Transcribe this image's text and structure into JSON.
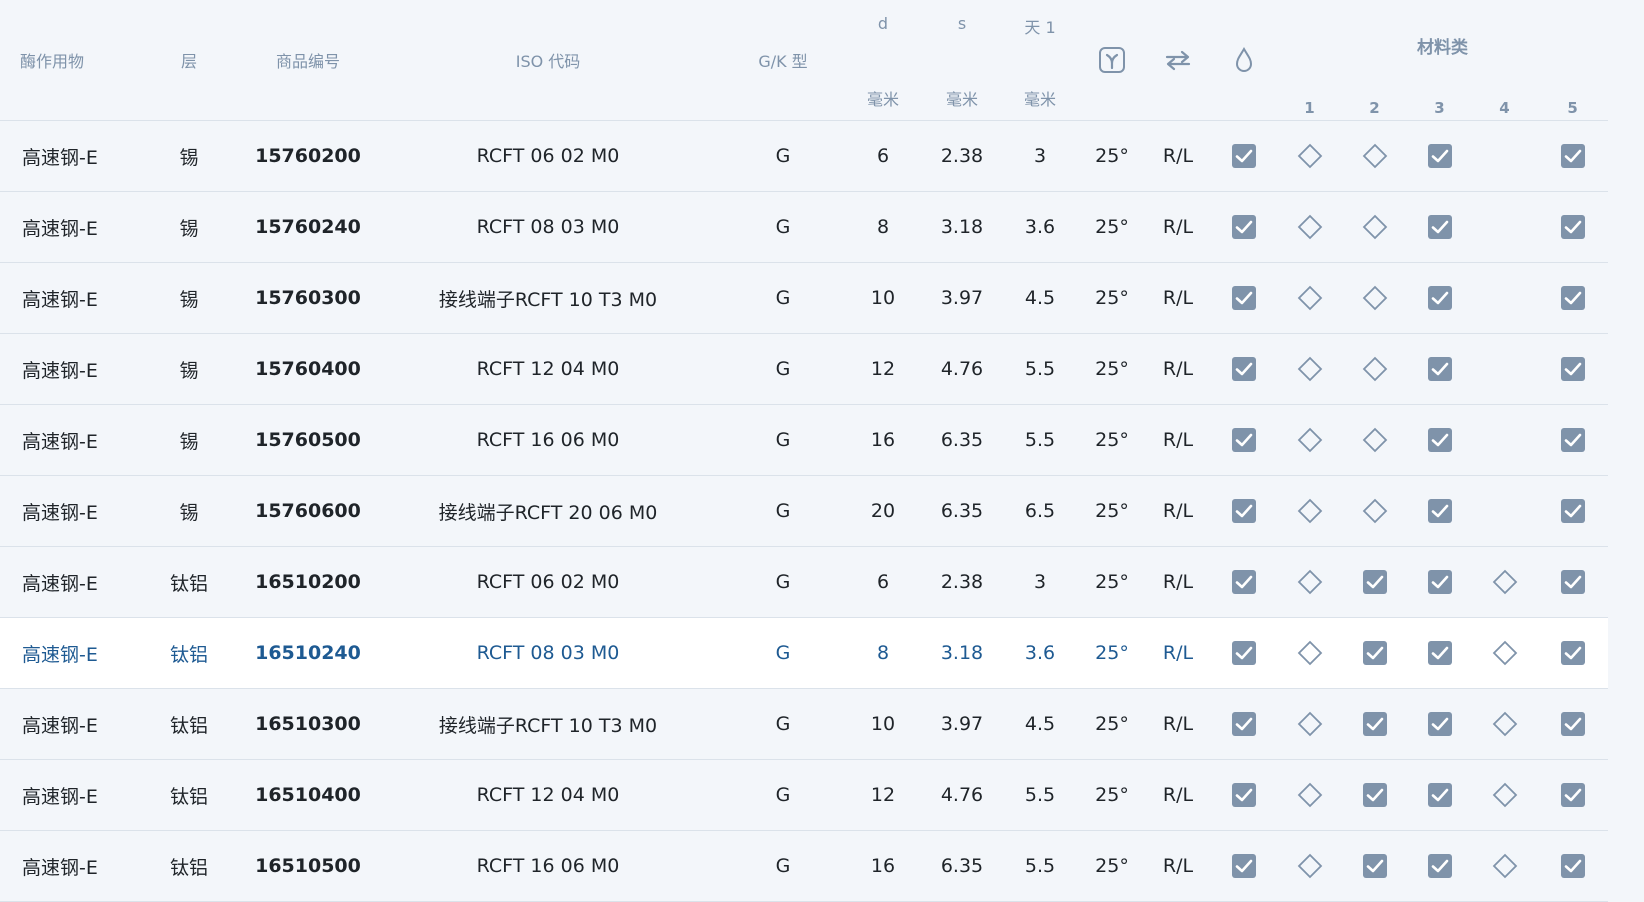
{
  "header": {
    "enzyme": "酶作用物",
    "layer": "层",
    "part_no": "商品编号",
    "iso": "ISO 代码",
    "gk": "G/K 型",
    "d": "d",
    "s": "s",
    "t1": "天 1",
    "unit_mm": "毫米",
    "gamma_icon": "gamma-angle-icon",
    "swap_icon": "swap-direction-icon",
    "drop_icon": "coolant-drop-icon",
    "material_title": "材料类",
    "material_cols": [
      "1",
      "2",
      "3",
      "4",
      "5"
    ]
  },
  "colors": {
    "checkbox": "#7f93aa",
    "selected_text": "#1e5a92",
    "header_text": "#7f93aa",
    "row_bg": "#f3f6fa",
    "selected_bg": "#ffffff"
  },
  "rows": [
    {
      "enzyme": "高速钢-E",
      "layer": "锡",
      "part_no": "15760200",
      "iso": "RCFT 06 02 M0",
      "gk": "G",
      "d": "6",
      "s": "2.38",
      "t1": "3",
      "angle": "25°",
      "dir": "R/L",
      "cool": "check",
      "mats": [
        "diamond",
        "diamond",
        "check",
        "",
        "check"
      ]
    },
    {
      "enzyme": "高速钢-E",
      "layer": "锡",
      "part_no": "15760240",
      "iso": "RCFT 08 03 M0",
      "gk": "G",
      "d": "8",
      "s": "3.18",
      "t1": "3.6",
      "angle": "25°",
      "dir": "R/L",
      "cool": "check",
      "mats": [
        "diamond",
        "diamond",
        "check",
        "",
        "check"
      ]
    },
    {
      "enzyme": "高速钢-E",
      "layer": "锡",
      "part_no": "15760300",
      "iso": "接线端子RCFT 10 T3 M0",
      "gk": "G",
      "d": "10",
      "s": "3.97",
      "t1": "4.5",
      "angle": "25°",
      "dir": "R/L",
      "cool": "check",
      "mats": [
        "diamond",
        "diamond",
        "check",
        "",
        "check"
      ]
    },
    {
      "enzyme": "高速钢-E",
      "layer": "锡",
      "part_no": "15760400",
      "iso": "RCFT 12 04 M0",
      "gk": "G",
      "d": "12",
      "s": "4.76",
      "t1": "5.5",
      "angle": "25°",
      "dir": "R/L",
      "cool": "check",
      "mats": [
        "diamond",
        "diamond",
        "check",
        "",
        "check"
      ]
    },
    {
      "enzyme": "高速钢-E",
      "layer": "锡",
      "part_no": "15760500",
      "iso": "RCFT 16 06 M0",
      "gk": "G",
      "d": "16",
      "s": "6.35",
      "t1": "5.5",
      "angle": "25°",
      "dir": "R/L",
      "cool": "check",
      "mats": [
        "diamond",
        "diamond",
        "check",
        "",
        "check"
      ]
    },
    {
      "enzyme": "高速钢-E",
      "layer": "锡",
      "part_no": "15760600",
      "iso": "接线端子RCFT 20 06 M0",
      "gk": "G",
      "d": "20",
      "s": "6.35",
      "t1": "6.5",
      "angle": "25°",
      "dir": "R/L",
      "cool": "check",
      "mats": [
        "diamond",
        "diamond",
        "check",
        "",
        "check"
      ]
    },
    {
      "enzyme": "高速钢-E",
      "layer": "钛铝",
      "part_no": "16510200",
      "iso": "RCFT 06 02 M0",
      "gk": "G",
      "d": "6",
      "s": "2.38",
      "t1": "3",
      "angle": "25°",
      "dir": "R/L",
      "cool": "check",
      "mats": [
        "diamond",
        "check",
        "check",
        "diamond",
        "check"
      ]
    },
    {
      "enzyme": "高速钢-E",
      "layer": "钛铝",
      "part_no": "16510240",
      "iso": "RCFT 08 03 M0",
      "gk": "G",
      "d": "8",
      "s": "3.18",
      "t1": "3.6",
      "angle": "25°",
      "dir": "R/L",
      "cool": "check",
      "mats": [
        "diamond",
        "check",
        "check",
        "diamond",
        "check"
      ],
      "selected": true
    },
    {
      "enzyme": "高速钢-E",
      "layer": "钛铝",
      "part_no": "16510300",
      "iso": "接线端子RCFT 10 T3 M0",
      "gk": "G",
      "d": "10",
      "s": "3.97",
      "t1": "4.5",
      "angle": "25°",
      "dir": "R/L",
      "cool": "check",
      "mats": [
        "diamond",
        "check",
        "check",
        "diamond",
        "check"
      ]
    },
    {
      "enzyme": "高速钢-E",
      "layer": "钛铝",
      "part_no": "16510400",
      "iso": "RCFT 12 04 M0",
      "gk": "G",
      "d": "12",
      "s": "4.76",
      "t1": "5.5",
      "angle": "25°",
      "dir": "R/L",
      "cool": "check",
      "mats": [
        "diamond",
        "check",
        "check",
        "diamond",
        "check"
      ]
    },
    {
      "enzyme": "高速钢-E",
      "layer": "钛铝",
      "part_no": "16510500",
      "iso": "RCFT 16 06 M0",
      "gk": "G",
      "d": "16",
      "s": "6.35",
      "t1": "5.5",
      "angle": "25°",
      "dir": "R/L",
      "cool": "check",
      "mats": [
        "diamond",
        "check",
        "check",
        "diamond",
        "check"
      ]
    }
  ]
}
